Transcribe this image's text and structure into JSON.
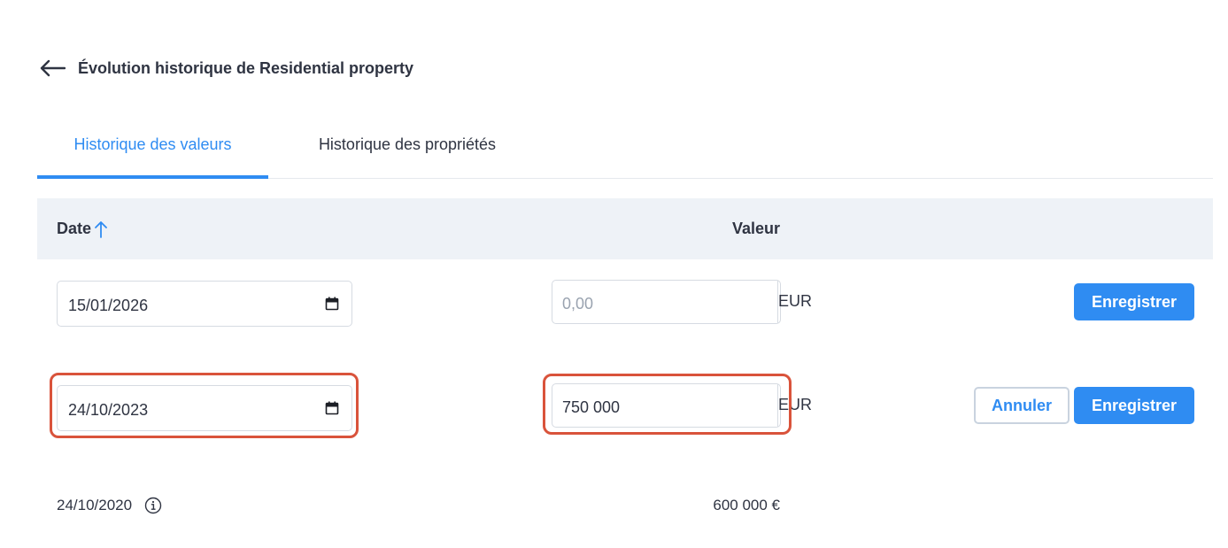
{
  "header": {
    "title": "Évolution historique de Residential property",
    "back_icon": "arrow-left-icon"
  },
  "tabs": [
    {
      "label": "Historique des valeurs",
      "active": true
    },
    {
      "label": "Historique des propriétés",
      "active": false
    }
  ],
  "table": {
    "columns": {
      "date": "Date",
      "value": "Valeur"
    },
    "sort": {
      "column": "date",
      "direction": "ascending",
      "icon": "arrow-up-icon"
    },
    "rows": [
      {
        "mode": "new",
        "date_value": "15/01/2026",
        "amount_value": "",
        "amount_placeholder": "0,00",
        "currency": "EUR",
        "save_label": "Enregistrer"
      },
      {
        "mode": "edit",
        "date_value": "24/10/2023",
        "amount_value": "750 000",
        "currency": "EUR",
        "cancel_label": "Annuler",
        "save_label": "Enregistrer"
      },
      {
        "mode": "view",
        "date": "24/10/2020",
        "info_icon": "info-icon",
        "value": "600 000 €"
      }
    ]
  },
  "colors": {
    "accent": "#2f8cf2",
    "highlight": "#d9533b",
    "header_bg": "#eef2f7",
    "text": "#2f3442"
  }
}
